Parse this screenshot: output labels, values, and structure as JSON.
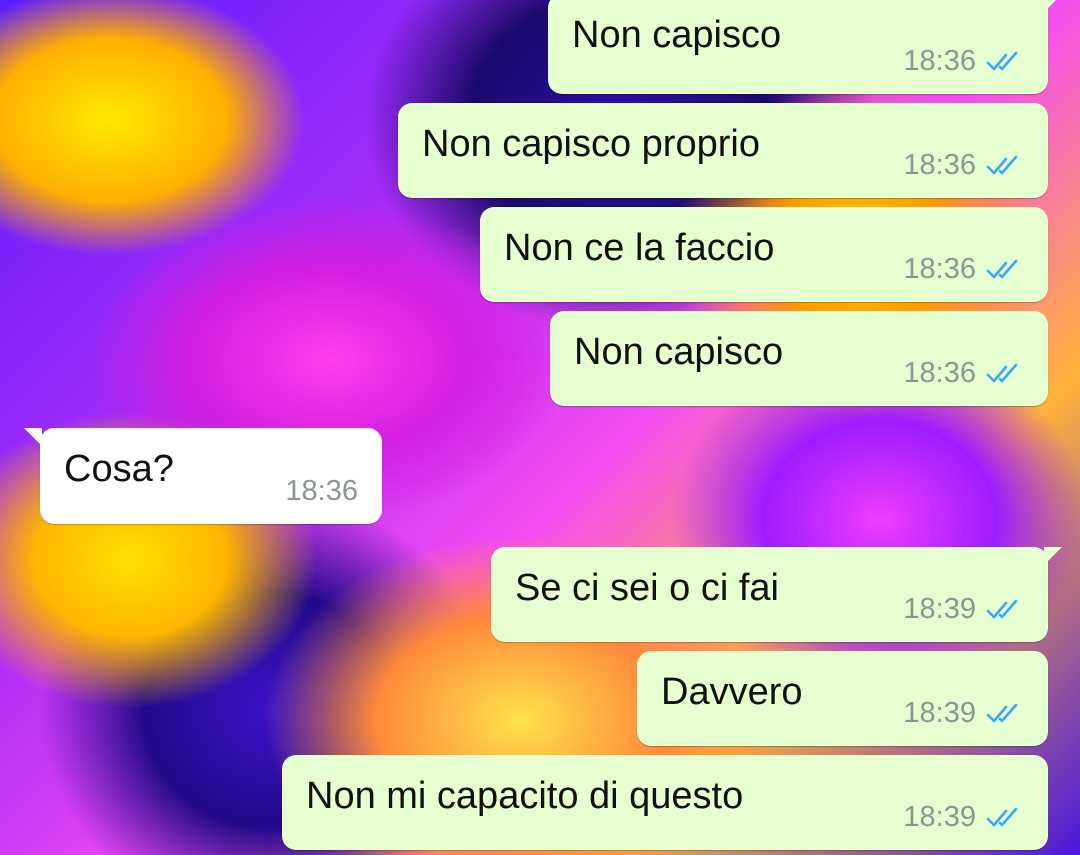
{
  "chat": {
    "messages": [
      {
        "text": "Non capisco",
        "time": "18:36",
        "direction": "outgoing",
        "status": "read",
        "tail": true
      },
      {
        "text": "Non capisco proprio",
        "time": "18:36",
        "direction": "outgoing",
        "status": "read"
      },
      {
        "text": "Non ce la faccio",
        "time": "18:36",
        "direction": "outgoing",
        "status": "read"
      },
      {
        "text": "Non capisco",
        "time": "18:36",
        "direction": "outgoing",
        "status": "read"
      },
      {
        "text": "Cosa?",
        "time": "18:36",
        "direction": "incoming",
        "tail": true
      },
      {
        "text": "Se ci sei o ci fai",
        "time": "18:39",
        "direction": "outgoing",
        "status": "read",
        "tail": true
      },
      {
        "text": "Davvero",
        "time": "18:39",
        "direction": "outgoing",
        "status": "read"
      },
      {
        "text": "Non mi capacito di questo",
        "time": "18:39",
        "direction": "outgoing",
        "status": "read"
      }
    ]
  },
  "colors": {
    "outgoing_bubble": "#e6ffd1",
    "incoming_bubble": "#ffffff",
    "read_check": "#3aa7f0",
    "timestamp": "#8c9690"
  },
  "icons": {
    "read_receipt": "double-check-icon"
  }
}
